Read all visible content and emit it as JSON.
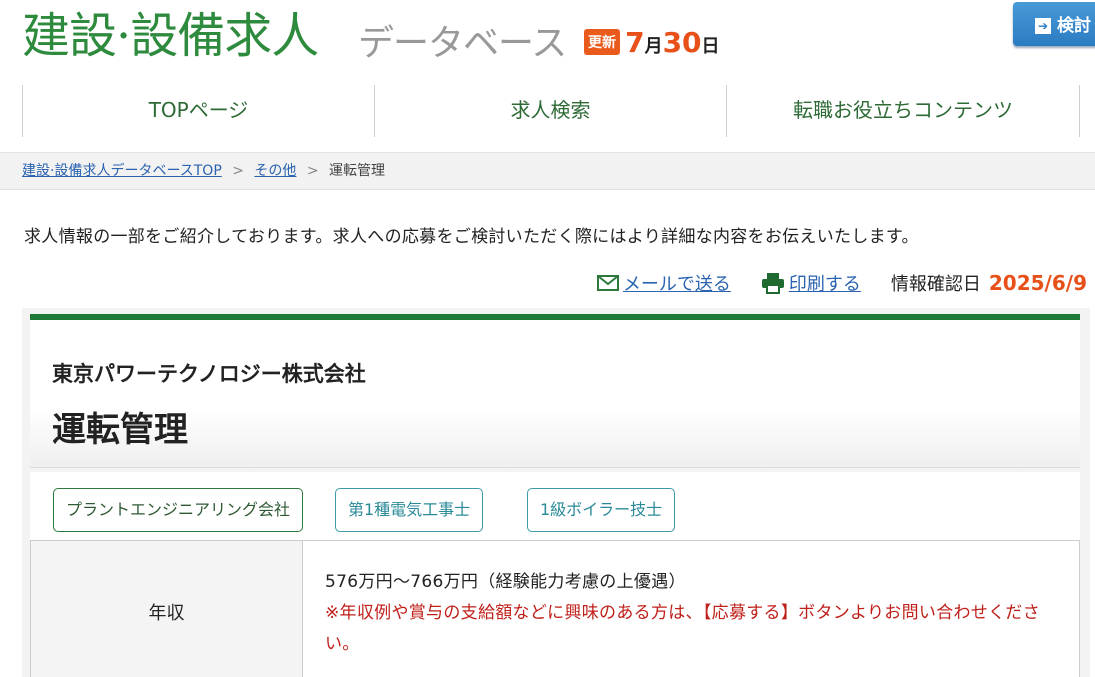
{
  "header": {
    "logo_main": "建設·設備求人",
    "logo_sub": "データベース",
    "update_badge": "更新",
    "update_month_num": "7",
    "update_month_unit": "月",
    "update_day_num": "30",
    "update_day_unit": "日",
    "search_button": "検討"
  },
  "nav": {
    "items": [
      "TOPページ",
      "求人検索",
      "転職お役立ちコンテンツ"
    ]
  },
  "breadcrumb": {
    "items": [
      "建設·設備求人データベースTOP",
      "その他"
    ],
    "current": "運転管理"
  },
  "intro": "求人情報の一部をご紹介しております。求人への応募をご検討いただく際にはより詳細な内容をお伝えいたします。",
  "actions": {
    "mail": "メールで送る",
    "print": "印刷する",
    "info_label": "情報確認日",
    "info_date": "2025/6/9"
  },
  "job": {
    "company": "東京パワーテクノロジー株式会社",
    "title": "運転管理",
    "tags": [
      "プラントエンジニアリング会社",
      "第1種電気工事士",
      "1級ボイラー技士"
    ],
    "salary_label": "年収",
    "salary_value": "576万円〜766万円（経験能力考慮の上優遇）",
    "salary_note": "※年収例や賞与の支給額などに興味のある方は、【応募する】ボタンよりお問い合わせください。"
  },
  "colors": {
    "brand_green": "#2e8b3e",
    "accent_orange": "#e8501a",
    "link_blue": "#2a63b0",
    "note_red": "#c0201a"
  }
}
